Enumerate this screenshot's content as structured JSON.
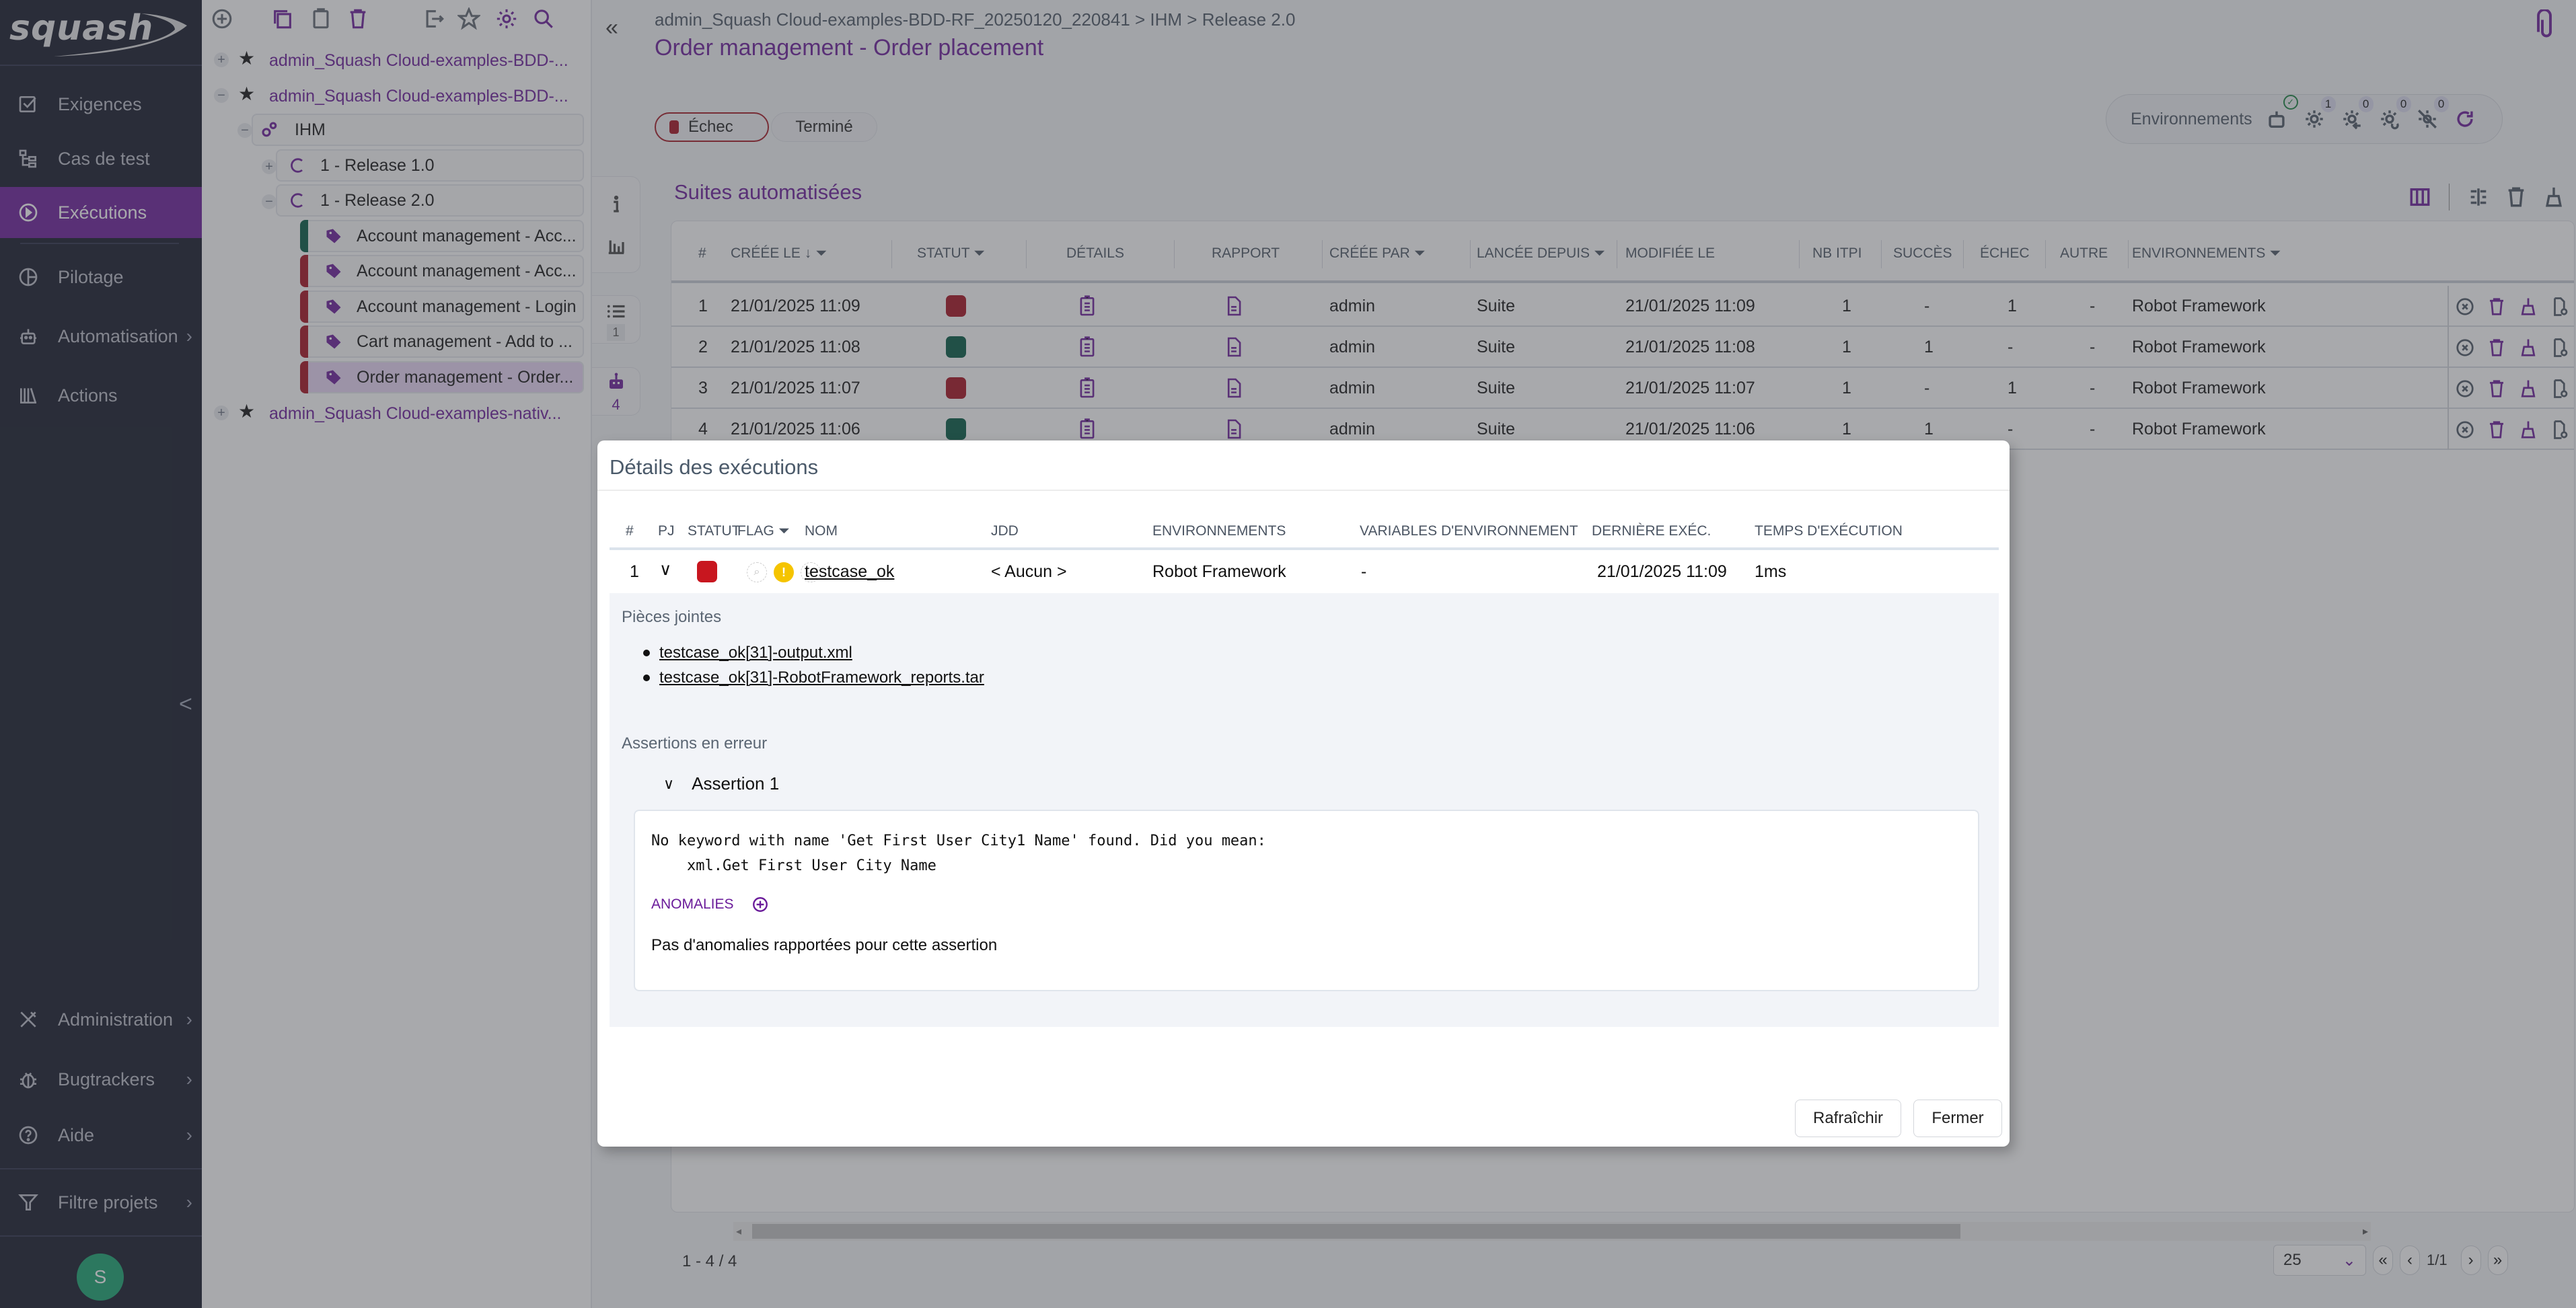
{
  "app": {
    "logo_text": "squash",
    "colors": {
      "brand": "#6a1b9a",
      "sidebar_bg": "#121627",
      "fail": "#a50f1d",
      "success": "#005740",
      "warning": "#f5c400"
    }
  },
  "sidebar": {
    "items": [
      {
        "label": "Exigences",
        "icon": "checkbox-icon",
        "active": false,
        "has_submenu": false
      },
      {
        "label": "Cas de test",
        "icon": "tree-icon",
        "active": false,
        "has_submenu": false
      },
      {
        "label": "Exécutions",
        "icon": "play-circle-icon",
        "active": true,
        "has_submenu": false
      },
      {
        "label": "Pilotage",
        "icon": "pie-chart-icon",
        "active": false,
        "has_submenu": false
      },
      {
        "label": "Automatisation",
        "icon": "robot-icon",
        "active": false,
        "has_submenu": true
      },
      {
        "label": "Actions",
        "icon": "library-icon",
        "active": false,
        "has_submenu": false
      }
    ],
    "bottom_items": [
      {
        "label": "Administration",
        "icon": "tools-icon",
        "has_submenu": true
      },
      {
        "label": "Bugtrackers",
        "icon": "bug-icon",
        "has_submenu": true
      },
      {
        "label": "Aide",
        "icon": "help-icon",
        "has_submenu": true
      },
      {
        "label": "Filtre projets",
        "icon": "filter-icon",
        "has_submenu": true
      }
    ],
    "collapse_icon": "chevron-left-icon",
    "avatar_initial": "S"
  },
  "tree": {
    "toolbar": [
      "add-icon",
      "copy-icon",
      "paste-icon",
      "delete-icon",
      "export-icon",
      "star-icon",
      "gear-icon",
      "search-icon"
    ],
    "projects": [
      {
        "label": "admin_Squash Cloud-examples-BDD-...",
        "expanded": false
      },
      {
        "label": "admin_Squash Cloud-examples-BDD-...",
        "expanded": true
      },
      {
        "label": "admin_Squash Cloud-examples-nativ...",
        "expanded": false
      }
    ],
    "campaign": {
      "label": "IHM"
    },
    "iterations": [
      {
        "label": "1 - Release 1.0",
        "expanded": false
      },
      {
        "label": "1 - Release 2.0",
        "expanded": true
      }
    ],
    "suites": [
      {
        "label": "Account management - Acc...",
        "status": "success",
        "selected": false
      },
      {
        "label": "Account management - Acc...",
        "status": "fail",
        "selected": false
      },
      {
        "label": "Account management - Login",
        "status": "fail",
        "selected": false
      },
      {
        "label": "Cart management - Add to ...",
        "status": "fail",
        "selected": false
      },
      {
        "label": "Order management - Order...",
        "status": "fail",
        "selected": true
      }
    ]
  },
  "header": {
    "breadcrumb": "admin_Squash Cloud-examples-BDD-RF_20250120_220841 > IHM > Release 2.0",
    "title": "Order management - Order placement",
    "status_pill": "Échec",
    "state_pill": "Terminé",
    "environments_label": "Environnements",
    "env_counts": {
      "idle": "1",
      "busy": "0",
      "pending": "0",
      "unreachable": "0"
    }
  },
  "side_tabs": {
    "plan_count": "1",
    "automated_count": "4"
  },
  "suites_section": {
    "title": "Suites automatisées",
    "columns": [
      "#",
      "Créée le",
      "Statut",
      "Détails",
      "Rapport",
      "Créée par",
      "Lancée depuis",
      "Modifiée le",
      "Nb ITPI",
      "Succès",
      "Échec",
      "Autre",
      "Environnements"
    ],
    "rows": [
      {
        "num": "1",
        "created": "21/01/2025 11:09",
        "status": "fail",
        "created_by": "admin",
        "launched_from": "Suite",
        "modified": "21/01/2025 11:09",
        "nb_itpi": "1",
        "success": "-",
        "failure": "1",
        "other": "-",
        "environments": "Robot Framework"
      },
      {
        "num": "2",
        "created": "21/01/2025 11:08",
        "status": "success",
        "created_by": "admin",
        "launched_from": "Suite",
        "modified": "21/01/2025 11:08",
        "nb_itpi": "1",
        "success": "1",
        "failure": "-",
        "other": "-",
        "environments": "Robot Framework"
      },
      {
        "num": "3",
        "created": "21/01/2025 11:07",
        "status": "fail",
        "created_by": "admin",
        "launched_from": "Suite",
        "modified": "21/01/2025 11:07",
        "nb_itpi": "1",
        "success": "-",
        "failure": "1",
        "other": "-",
        "environments": "Robot Framework"
      },
      {
        "num": "4",
        "created": "21/01/2025 11:06",
        "status": "success",
        "created_by": "admin",
        "launched_from": "Suite",
        "modified": "21/01/2025 11:06",
        "nb_itpi": "1",
        "success": "1",
        "failure": "-",
        "other": "-",
        "environments": "Robot Framework"
      }
    ],
    "pagination": {
      "range": "1 - 4 / 4",
      "page_size": "25",
      "page": "1/1"
    }
  },
  "modal": {
    "title": "Détails des exécutions",
    "columns": [
      "#",
      "PJ",
      "Statut",
      "Flag",
      "Nom",
      "JDD",
      "Environnements",
      "Variables d'environnement",
      "Dernière exéc.",
      "Temps d'exécution"
    ],
    "row": {
      "num": "1",
      "status": "fail",
      "name": "testcase_ok",
      "dataset": "< Aucun >",
      "environments": "Robot Framework",
      "env_variables": "-",
      "last_exec": "21/01/2025 11:09",
      "duration": "1ms"
    },
    "attachments_label": "Pièces jointes",
    "attachments": [
      "testcase_ok[31]-output.xml",
      "testcase_ok[31]-RobotFramework_reports.tar"
    ],
    "failed_assertions_label": "Assertions en erreur",
    "assertion": {
      "title": "Assertion 1",
      "message": "No keyword with name 'Get First User City1 Name' found. Did you mean:\n    xml.Get First User City Name",
      "anomalies_label": "ANOMALIES",
      "no_anomalies": "Pas d'anomalies rapportées pour cette assertion"
    },
    "refresh_label": "Rafraîchir",
    "close_label": "Fermer"
  }
}
